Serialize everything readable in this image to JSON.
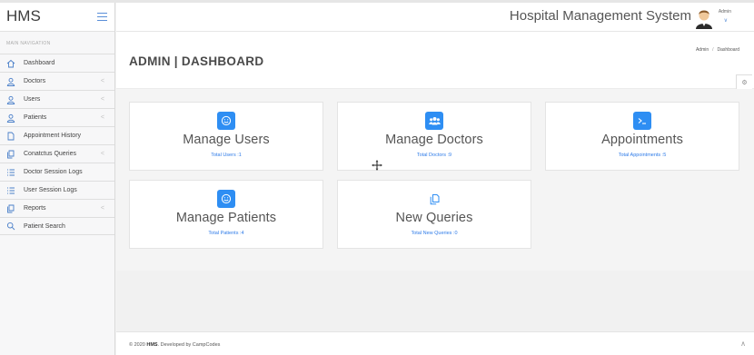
{
  "app": {
    "brand": "HMS",
    "system_title": "Hospital Management System",
    "admin_label": "Admin"
  },
  "sidebar": {
    "nav_header": "MAIN NAVIGATION",
    "items": [
      {
        "label": "Dashboard",
        "icon": "home-icon",
        "has_submenu": false
      },
      {
        "label": "Doctors",
        "icon": "user-icon",
        "has_submenu": true
      },
      {
        "label": "Users",
        "icon": "user-icon",
        "has_submenu": true
      },
      {
        "label": "Patients",
        "icon": "user-icon",
        "has_submenu": true
      },
      {
        "label": "Appointment History",
        "icon": "file-icon",
        "has_submenu": false
      },
      {
        "label": "Conatctus Queries",
        "icon": "files-icon",
        "has_submenu": true
      },
      {
        "label": "Doctor Session Logs",
        "icon": "list-icon",
        "has_submenu": false
      },
      {
        "label": "User Session Logs",
        "icon": "list-icon",
        "has_submenu": false
      },
      {
        "label": "Reports",
        "icon": "files-icon",
        "has_submenu": true
      },
      {
        "label": "Patient Search",
        "icon": "search-icon",
        "has_submenu": false
      }
    ]
  },
  "page": {
    "title": "ADMIN | DASHBOARD",
    "breadcrumb": [
      "Admin",
      "Dashboard"
    ]
  },
  "cards": [
    {
      "title": "Manage Users",
      "link": "Total Users :1",
      "icon": "smile-icon"
    },
    {
      "title": "Manage Doctors",
      "link": "Total Doctors :9",
      "icon": "users-icon"
    },
    {
      "title": "Appointments",
      "link": "Total Appointments :5",
      "icon": "terminal-icon"
    },
    {
      "title": "Manage Patients",
      "link": "Total Patients :4",
      "icon": "smile-icon"
    },
    {
      "title": "New Queries",
      "link": "Total New Queries :0",
      "icon": "files-icon"
    }
  ],
  "footer": {
    "prefix": "© 2020 ",
    "brand": "HMS",
    "suffix": ". Developed by CampCodes"
  },
  "colors": {
    "accent": "#2e8ef3",
    "nav_icon": "#4a7fc9"
  }
}
